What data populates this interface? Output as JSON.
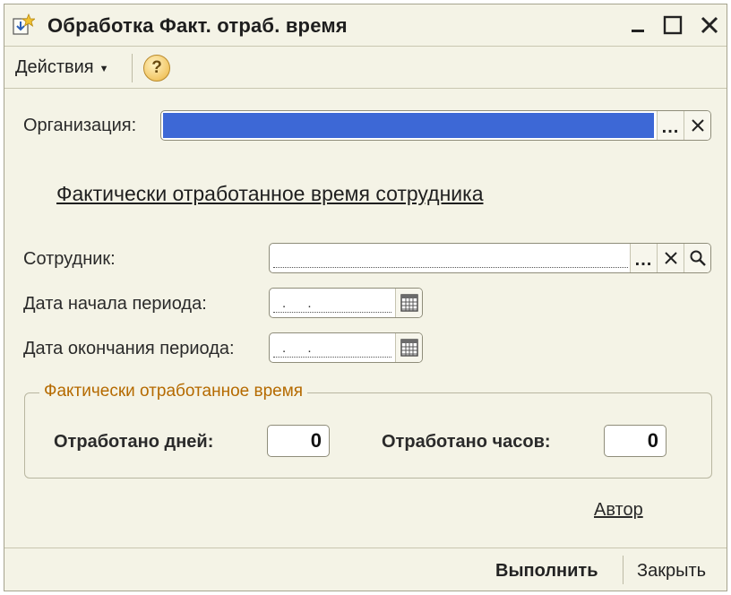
{
  "window": {
    "title": "Обработка  Факт. отраб. время"
  },
  "toolbar": {
    "actions_label": "Действия",
    "help_label": "?"
  },
  "form": {
    "organization_label": "Организация:",
    "organization_dots": "...",
    "section_title": "Фактически отработанное время сотрудника",
    "employee_label": "Сотрудник:",
    "employee_dots": "...",
    "start_date_label": "Дата начала периода:",
    "start_date_mask": ". .",
    "end_date_label": "Дата окончания периода:",
    "end_date_mask": ". .",
    "author_link": "Автор"
  },
  "group": {
    "title": "Фактически отработанное время",
    "days_label": "Отработано дней:",
    "days_value": "0",
    "hours_label": "Отработано часов:",
    "hours_value": "0"
  },
  "footer": {
    "run_label": "Выполнить",
    "close_label": "Закрыть"
  },
  "colors": {
    "window_bg": "#f4f3e6",
    "selection_blue": "#3d68d6",
    "group_title": "#b56a00"
  }
}
